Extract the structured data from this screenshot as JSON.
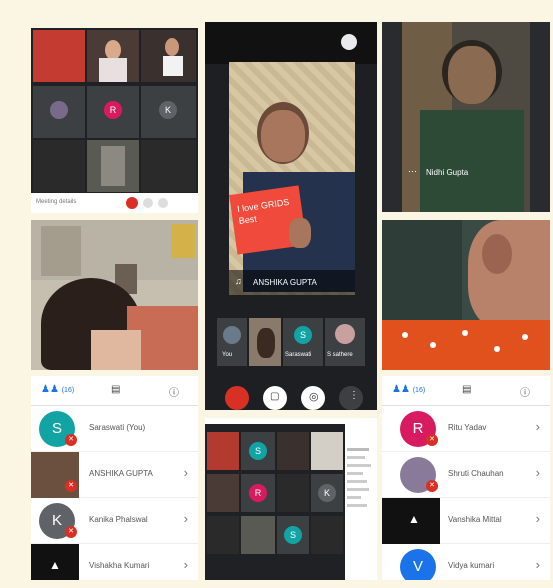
{
  "call_a": {
    "footer_text": "Meeting details",
    "participants": [
      {
        "initial": "",
        "color": "#5f6368"
      },
      {
        "initial": "R",
        "color": "#d81b60"
      },
      {
        "initial": "K",
        "color": "#5f6368"
      }
    ]
  },
  "call_b": {
    "speaker_name": "ANSHIKA GUPTA",
    "sign_text": "I love GRIDS Best",
    "thumbnails": [
      {
        "label": "You"
      },
      {
        "label": ""
      },
      {
        "label": "Saraswati"
      },
      {
        "label": "S sathere"
      }
    ],
    "thumb_initial": "S"
  },
  "call_c": {
    "speaker_name": "Nidhi Gupta"
  },
  "list_a": {
    "tab_count": "(16)",
    "rows": [
      {
        "initial": "S",
        "color": "#12a4a4",
        "name": "Saraswati (You)"
      },
      {
        "initial": "",
        "color": "#6b4f3f",
        "name": "ANSHIKA GUPTA"
      },
      {
        "initial": "K",
        "color": "#5f6368",
        "name": "Kanika Phalswal"
      },
      {
        "initial": "",
        "color": "#111111",
        "name": "Vishakha Kumari"
      }
    ]
  },
  "call_d": {
    "tiles": [
      {
        "initial": "S",
        "color": "#12a4a4"
      },
      {
        "initial": "R",
        "color": "#d81b60"
      },
      {
        "initial": "K",
        "color": "#5f6368"
      },
      {
        "initial": "S",
        "color": "#12a4a4"
      }
    ]
  },
  "list_c": {
    "tab_count": "(16)",
    "rows": [
      {
        "initial": "R",
        "color": "#d81b60",
        "name": "Ritu Yadav"
      },
      {
        "initial": "",
        "color": "#8a7a9a",
        "name": "Shruti Chauhan"
      },
      {
        "initial": "",
        "color": "#111111",
        "name": "Vanshika Mittal"
      },
      {
        "initial": "V",
        "color": "#1a73e8",
        "name": "Vidya kumari"
      }
    ]
  },
  "colors": {
    "meet_dark": "#202124",
    "end_call": "#d93025",
    "accent_blue": "#1a73e8"
  }
}
